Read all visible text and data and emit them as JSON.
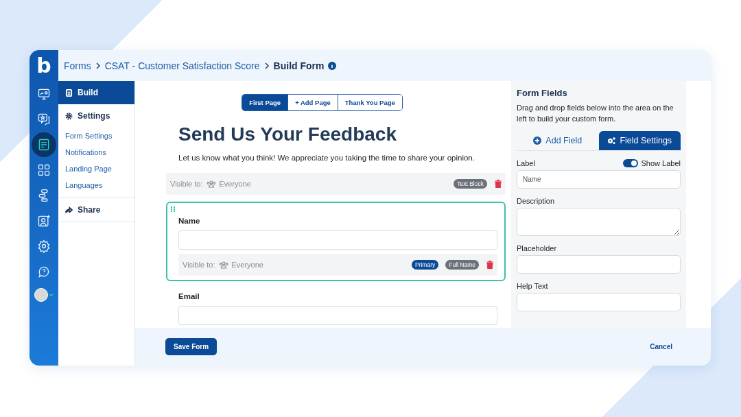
{
  "logo": {
    "letter": "b"
  },
  "rail": [
    {
      "kind": "monitor",
      "selected": false
    },
    {
      "kind": "chat",
      "selected": false
    },
    {
      "kind": "form",
      "selected": true
    },
    {
      "kind": "grid",
      "selected": false
    },
    {
      "kind": "flow",
      "selected": false
    },
    {
      "kind": "contact",
      "selected": false
    },
    {
      "kind": "gear",
      "selected": false
    },
    {
      "kind": "help",
      "selected": false
    }
  ],
  "breadcrumb": [
    "Forms",
    "CSAT - Customer Satisfaction Score",
    "Build Form"
  ],
  "nav": [
    {
      "kind": "section",
      "label": "Build",
      "selected": true
    },
    {
      "kind": "section",
      "label": "Settings",
      "selected": false
    },
    {
      "kind": "link",
      "label": "Form Settings",
      "selected": false
    },
    {
      "kind": "link",
      "label": "Notifications",
      "selected": false
    },
    {
      "kind": "link",
      "label": "Landing Page",
      "selected": false
    },
    {
      "kind": "link",
      "label": "Languages",
      "selected": false
    },
    {
      "kind": "section",
      "label": "Share",
      "selected": false
    }
  ],
  "page_tabs": [
    {
      "label": "First Page",
      "selected": true
    },
    {
      "label": "+ Add Page",
      "selected": false
    },
    {
      "label": "Thank You Page",
      "selected": false
    }
  ],
  "form": {
    "title": "Send Us Your Feedback",
    "intro": "Let us know what you think! We appreciate you taking the time to share your opinion.",
    "blocks": [
      {
        "kind": "text_block",
        "visible_label": "Visible to:",
        "audience": "Everyone",
        "tags": [
          {
            "kind": "type",
            "label": "Text Block"
          }
        ]
      },
      {
        "kind": "field",
        "selected": true,
        "label": "Name",
        "visible_label": "Visible to:",
        "audience": "Everyone",
        "tags": [
          {
            "kind": "primary",
            "label": "Primary"
          },
          {
            "kind": "type",
            "label": "Full Name"
          }
        ]
      },
      {
        "kind": "field",
        "selected": false,
        "label": "Email"
      }
    ]
  },
  "panel": {
    "title": "Form Fields",
    "description": "Drag and drop fields below into the area on the left to build your custom form.",
    "tabs": [
      {
        "label": "Add Field",
        "selected": false
      },
      {
        "label": "Field Settings",
        "selected": true
      }
    ],
    "show_label": {
      "label": "Show Label",
      "on": true
    },
    "fields": [
      {
        "kind": "input",
        "label": "Label",
        "value": "Name"
      },
      {
        "kind": "textarea",
        "label": "Description"
      },
      {
        "kind": "input",
        "label": "Placeholder"
      },
      {
        "kind": "input",
        "label": "Help Text"
      }
    ]
  },
  "footer": {
    "save": "Save Form",
    "cancel": "Cancel"
  }
}
